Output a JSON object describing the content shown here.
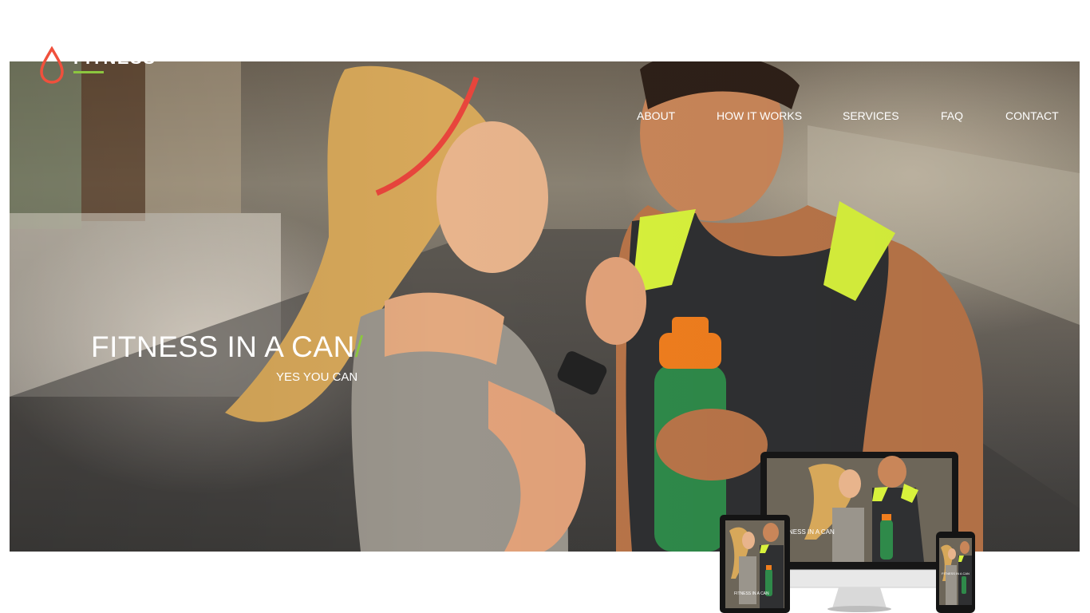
{
  "brand": {
    "name": "FITNESS",
    "accent": "#8cc63f",
    "drop_color": "#f0503c"
  },
  "nav": {
    "items": [
      {
        "label": "ABOUT"
      },
      {
        "label": "HOW IT WORKS"
      },
      {
        "label": "SERVICES"
      },
      {
        "label": "FAQ"
      },
      {
        "label": "CONTACT"
      }
    ]
  },
  "hero": {
    "title": "FITNESS IN A CAN",
    "title_suffix": "/",
    "subtitle": "YES YOU CAN"
  },
  "devices": {
    "monitor_caption": "NESS IN A CAN",
    "tablet_caption": "FITNESS IN A CAN",
    "phone_caption": "FITNESS IN A CAN"
  }
}
